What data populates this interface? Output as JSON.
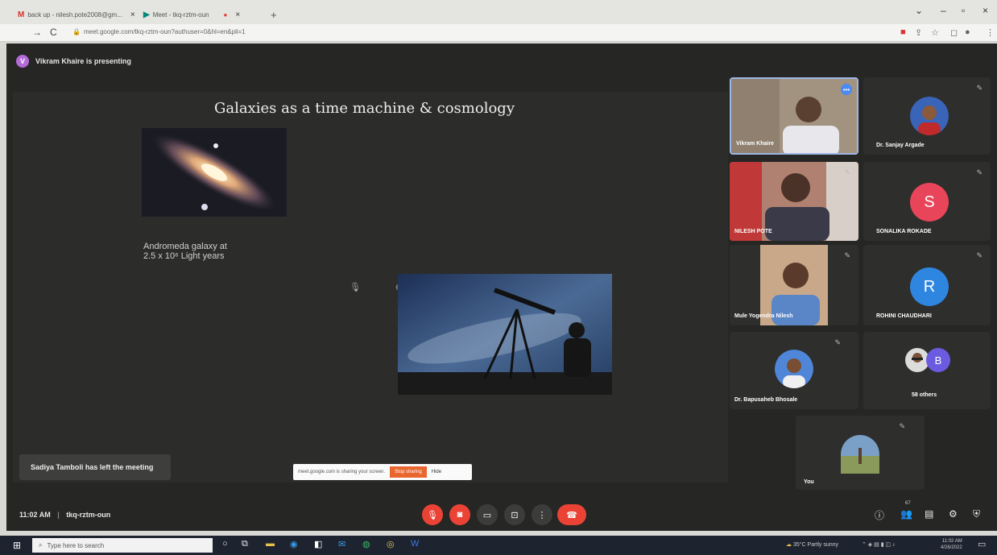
{
  "browser": {
    "tabs": [
      {
        "icon": "M",
        "title": "back up - nilesh.pote2008@gm..."
      },
      {
        "icon": "▶",
        "title": "Meet - tkq-rztm-oun"
      }
    ],
    "url": "meet.google.com/tkq-rztm-oun?authuser=0&hl=en&pli=1"
  },
  "meet": {
    "presenter_initial": "V",
    "presenter_text": "Vikram Khaire is presenting",
    "slide_title": "Galaxies as a time machine & cosmology",
    "caption_line1": "Andromeda galaxy at",
    "caption_line2": "2.5 x 10⁶ Light years",
    "toast": "Sadiya Tamboli has left the meeting",
    "share_text": "meet.google.com is sharing your screen.",
    "stop_label": "Stop sharing",
    "hide_label": "Hide",
    "time": "11:02 AM",
    "meeting_code": "tkq-rztm-oun"
  },
  "participants": [
    {
      "name": "Vikram Khaire"
    },
    {
      "name": "Dr. Sanjay Argade"
    },
    {
      "name": "NILESH POTE"
    },
    {
      "name": "SONALIKA ROKADE",
      "initial": "S",
      "color": "#e8455a"
    },
    {
      "name": "Mule Yogendra Nilesh"
    },
    {
      "name": "ROHINI CHAUDHARI",
      "initial": "R",
      "color": "#2f86e0"
    },
    {
      "name": "Dr. Bapusaheb Bhosale"
    },
    {
      "name": "58 others",
      "initial": "B",
      "color": "#6a5be0"
    },
    {
      "name": "You"
    }
  ],
  "taskbar": {
    "search_placeholder": "Type here to search",
    "weather": "35°C  Partly sunny",
    "clock_time": "11:02 AM",
    "clock_date": "4/26/2022"
  }
}
